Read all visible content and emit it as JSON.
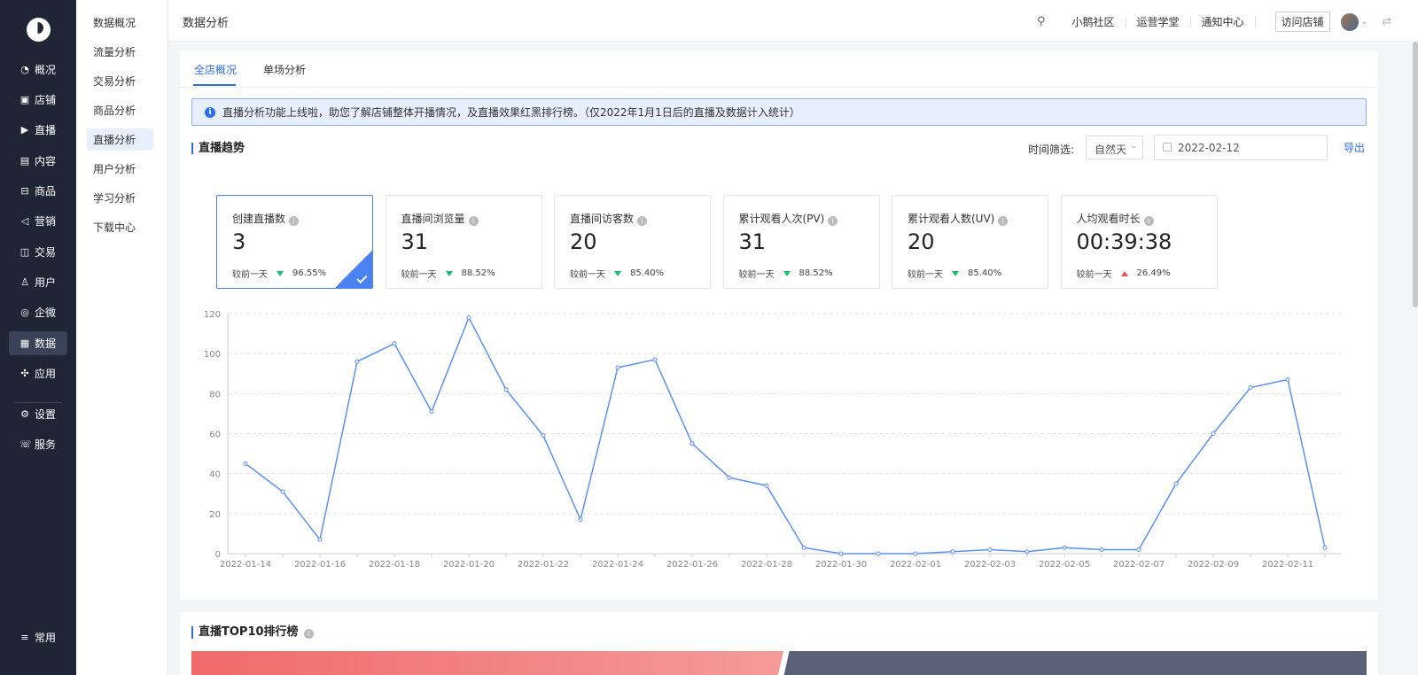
{
  "nav": {
    "items": [
      {
        "label": "概况",
        "icon": "pie-icon"
      },
      {
        "label": "店铺",
        "icon": "shop-icon"
      },
      {
        "label": "直播",
        "icon": "live-icon"
      },
      {
        "label": "内容",
        "icon": "document-icon"
      },
      {
        "label": "商品",
        "icon": "goods-icon"
      },
      {
        "label": "营销",
        "icon": "megaphone-icon"
      },
      {
        "label": "交易",
        "icon": "trade-icon"
      },
      {
        "label": "用户",
        "icon": "user-icon"
      },
      {
        "label": "企微",
        "icon": "chat-icon"
      },
      {
        "label": "数据",
        "icon": "data-icon"
      },
      {
        "label": "应用",
        "icon": "apps-icon"
      },
      {
        "label": "设置",
        "icon": "gear-icon"
      },
      {
        "label": "服务",
        "icon": "service-icon"
      }
    ],
    "bottom": {
      "label": "常用",
      "icon": "list-icon"
    },
    "active": "数据"
  },
  "subnav": {
    "items": [
      "数据概况",
      "流量分析",
      "交易分析",
      "商品分析",
      "直播分析",
      "用户分析",
      "学习分析",
      "下载中心"
    ],
    "active": "直播分析"
  },
  "header": {
    "title": "数据分析",
    "links": [
      "小鹅社区",
      "运营学堂",
      "通知中心"
    ],
    "visit_button": "访问店铺"
  },
  "tabs": [
    "全店概况",
    "单场分析"
  ],
  "notice": "直播分析功能上线啦，助您了解店铺整体开播情况，及直播效果红黑排行榜。（仅2022年1月1日后的直播及数据计入统计）",
  "trend": {
    "title": "直播趋势",
    "filter_label": "时间筛选:",
    "filter_value": "自然天",
    "date": "2022-02-12",
    "export": "导出"
  },
  "cards": [
    {
      "label": "创建直播数",
      "value": "3",
      "cmp_label": "较前一天",
      "direction": "down",
      "pct": "96.55%"
    },
    {
      "label": "直播间浏览量",
      "value": "31",
      "cmp_label": "较前一天",
      "direction": "down",
      "pct": "88.52%"
    },
    {
      "label": "直播间访客数",
      "value": "20",
      "cmp_label": "较前一天",
      "direction": "down",
      "pct": "85.40%"
    },
    {
      "label": "累计观看人次(PV)",
      "value": "31",
      "cmp_label": "较前一天",
      "direction": "down",
      "pct": "88.52%"
    },
    {
      "label": "累计观看人数(UV)",
      "value": "20",
      "cmp_label": "较前一天",
      "direction": "down",
      "pct": "85.40%"
    },
    {
      "label": "人均观看时长",
      "value": "00:39:38",
      "cmp_label": "较前一天",
      "direction": "up",
      "pct": "26.49%"
    }
  ],
  "colors": {
    "accent": "#2d6cf0",
    "line": "#5b8ff9",
    "down": "#1dbf6a",
    "up": "#f05454"
  },
  "chart_data": {
    "type": "line",
    "x": [
      "2022-01-14",
      "2022-01-15",
      "2022-01-16",
      "2022-01-17",
      "2022-01-18",
      "2022-01-19",
      "2022-01-20",
      "2022-01-21",
      "2022-01-22",
      "2022-01-23",
      "2022-01-24",
      "2022-01-25",
      "2022-01-26",
      "2022-01-27",
      "2022-01-28",
      "2022-01-29",
      "2022-01-30",
      "2022-01-31",
      "2022-02-01",
      "2022-02-02",
      "2022-02-03",
      "2022-02-04",
      "2022-02-05",
      "2022-02-06",
      "2022-02-07",
      "2022-02-08",
      "2022-02-09",
      "2022-02-10",
      "2022-02-11",
      "2022-02-12"
    ],
    "tick_labels": [
      "2022-01-14",
      "2022-01-16",
      "2022-01-18",
      "2022-01-20",
      "2022-01-22",
      "2022-01-24",
      "2022-01-26",
      "2022-01-28",
      "2022-01-30",
      "2022-02-01",
      "2022-02-03",
      "2022-02-05",
      "2022-02-07",
      "2022-02-09",
      "2022-02-11"
    ],
    "series": [
      {
        "values": [
          45,
          31,
          7,
          96,
          105,
          71,
          118,
          82,
          59,
          17,
          93,
          97,
          55,
          38,
          34,
          3,
          0,
          0,
          0,
          1,
          2,
          1,
          3,
          2,
          2,
          35,
          60,
          83,
          87,
          3
        ]
      }
    ],
    "ylim": [
      0,
      120
    ],
    "yticks": [
      0,
      20,
      40,
      60,
      80,
      100,
      120
    ],
    "grid": true
  },
  "ranking": {
    "title": "直播TOP10排行榜"
  }
}
